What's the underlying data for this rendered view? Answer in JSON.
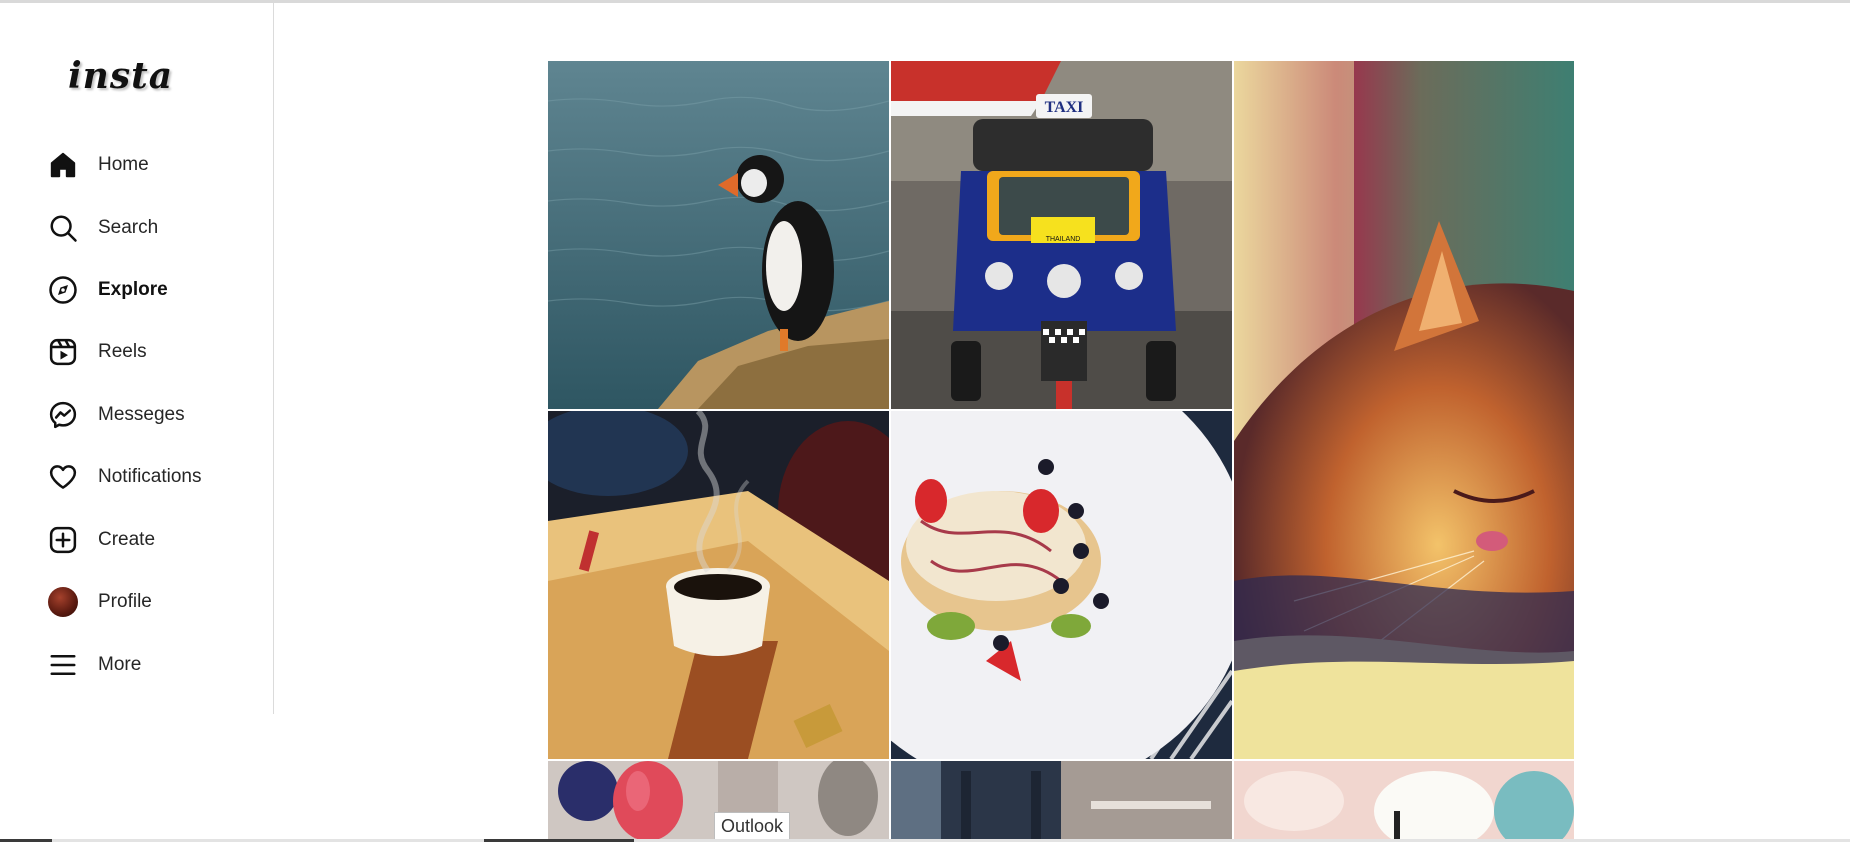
{
  "app": {
    "logo": "insta"
  },
  "sidebar": {
    "items": [
      {
        "label": "Home",
        "icon": "home-icon",
        "active": false
      },
      {
        "label": "Search",
        "icon": "search-icon",
        "active": false
      },
      {
        "label": "Explore",
        "icon": "compass-icon",
        "active": true
      },
      {
        "label": "Reels",
        "icon": "reels-icon",
        "active": false
      },
      {
        "label": "Messeges",
        "icon": "messenger-icon",
        "active": false
      },
      {
        "label": "Notifications",
        "icon": "heart-icon",
        "active": false
      },
      {
        "label": "Create",
        "icon": "plus-square-icon",
        "active": false
      },
      {
        "label": "Profile",
        "icon": "avatar",
        "active": false
      },
      {
        "label": "More",
        "icon": "menu-icon",
        "active": false
      }
    ]
  },
  "explore": {
    "posts": [
      {
        "subject": "puffin-on-cliff"
      },
      {
        "subject": "tuk-tuk-taxi",
        "sign_text": "TAXI",
        "plate_text": "THAILAND"
      },
      {
        "subject": "sleeping-cat"
      },
      {
        "subject": "coffee-cup"
      },
      {
        "subject": "pancakes-with-fruit"
      },
      {
        "subject": "lanterns"
      },
      {
        "subject": "person-in-denim"
      },
      {
        "subject": "dessert"
      }
    ]
  },
  "taskbar": {
    "tooltip": "Outlook"
  },
  "colors": {
    "accent": "#262626",
    "border": "#dbdbdb",
    "background": "#ffffff"
  }
}
